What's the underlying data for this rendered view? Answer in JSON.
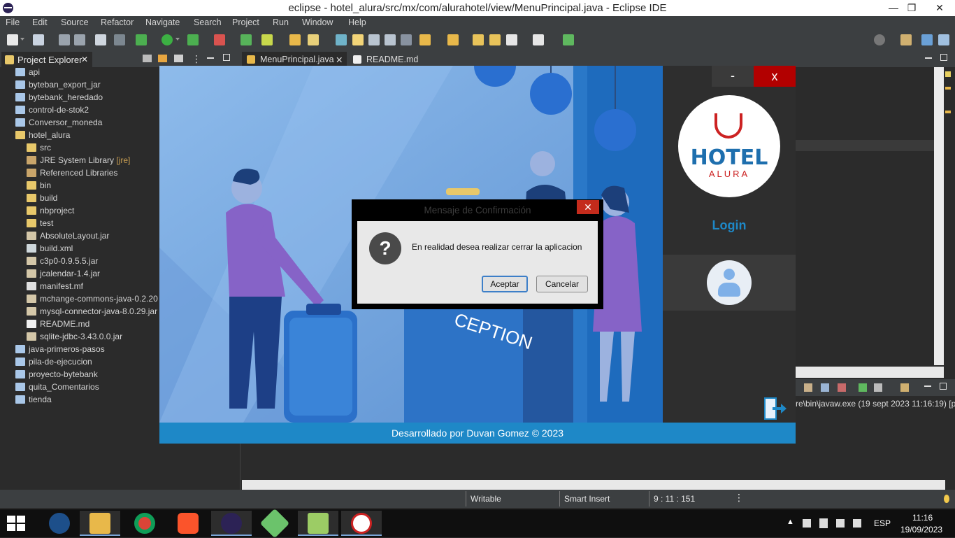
{
  "window": {
    "title": "eclipse - hotel_alura/src/mx/com/alurahotel/view/MenuPrincipal.java - Eclipse IDE",
    "minimize": "—",
    "restore": "❐",
    "close": "✕"
  },
  "menu": [
    "File",
    "Edit",
    "Source",
    "Refactor",
    "Navigate",
    "Search",
    "Project",
    "Run",
    "Window",
    "Help"
  ],
  "explorer": {
    "tab_label": "Project Explorer",
    "tab_close": "✕",
    "items": [
      {
        "label": "api",
        "icon": "folder"
      },
      {
        "label": "byteban_export_jar",
        "icon": "folder"
      },
      {
        "label": "bytebank_heredado",
        "icon": "folder"
      },
      {
        "label": "control-de-stok2",
        "icon": "folder"
      },
      {
        "label": "Conversor_moneda",
        "icon": "folder"
      },
      {
        "label": "hotel_alura",
        "icon": "folder"
      },
      {
        "label": "src",
        "icon": "package"
      },
      {
        "label": "JRE System Library",
        "icon": "library",
        "tag": "[jre]"
      },
      {
        "label": "Referenced Libraries",
        "icon": "library"
      },
      {
        "label": "bin",
        "icon": "folder"
      },
      {
        "label": "build",
        "icon": "folder"
      },
      {
        "label": "nbproject",
        "icon": "folder"
      },
      {
        "label": "test",
        "icon": "folder"
      },
      {
        "label": "AbsoluteLayout.jar",
        "icon": "jar"
      },
      {
        "label": "build.xml",
        "icon": "xml"
      },
      {
        "label": "c3p0-0.9.5.5.jar",
        "icon": "jar"
      },
      {
        "label": "jcalendar-1.4.jar",
        "icon": "jar"
      },
      {
        "label": "manifest.mf",
        "icon": "file"
      },
      {
        "label": "mchange-commons-java-0.2.20",
        "icon": "jar"
      },
      {
        "label": "mysql-connector-java-8.0.29.jar",
        "icon": "jar"
      },
      {
        "label": "README.md",
        "icon": "md"
      },
      {
        "label": "sqlite-jdbc-3.43.0.0.jar",
        "icon": "jar"
      },
      {
        "label": "java-primeros-pasos",
        "icon": "folder"
      },
      {
        "label": "pila-de-ejecucion",
        "icon": "folder"
      },
      {
        "label": "proyecto-bytebank",
        "icon": "folder"
      },
      {
        "label": "quita_Comentarios",
        "icon": "folder"
      },
      {
        "label": "tienda",
        "icon": "folder"
      }
    ]
  },
  "editor": {
    "tabs": [
      {
        "label": "MenuPrincipal.java",
        "close": "✕"
      },
      {
        "label": "README.md"
      }
    ]
  },
  "console": {
    "path_text": "re\\bin\\javaw.exe  (19 sept 2023 11:16:19) [pi"
  },
  "status": {
    "writable": "Writable",
    "insert_mode": "Smart Insert",
    "position": "9 : 11 : 151"
  },
  "app": {
    "minimize_label": "-",
    "close_label": "x",
    "logo_line1": "HOTEL",
    "logo_line2": "ALURA",
    "login_title": "Login",
    "footer": "Desarrollado por Duvan Gomez © 2023",
    "reception_text": "CEPTION"
  },
  "dialog": {
    "title": "Mensaje de Confirmación",
    "close": "✕",
    "icon_glyph": "?",
    "message": "En realidad desea realizar cerrar la aplicacion",
    "ok_label": "Aceptar",
    "cancel_label": "Cancelar"
  },
  "taskbar": {
    "language": "ESP",
    "time": "11:16",
    "date": "19/09/2023"
  }
}
